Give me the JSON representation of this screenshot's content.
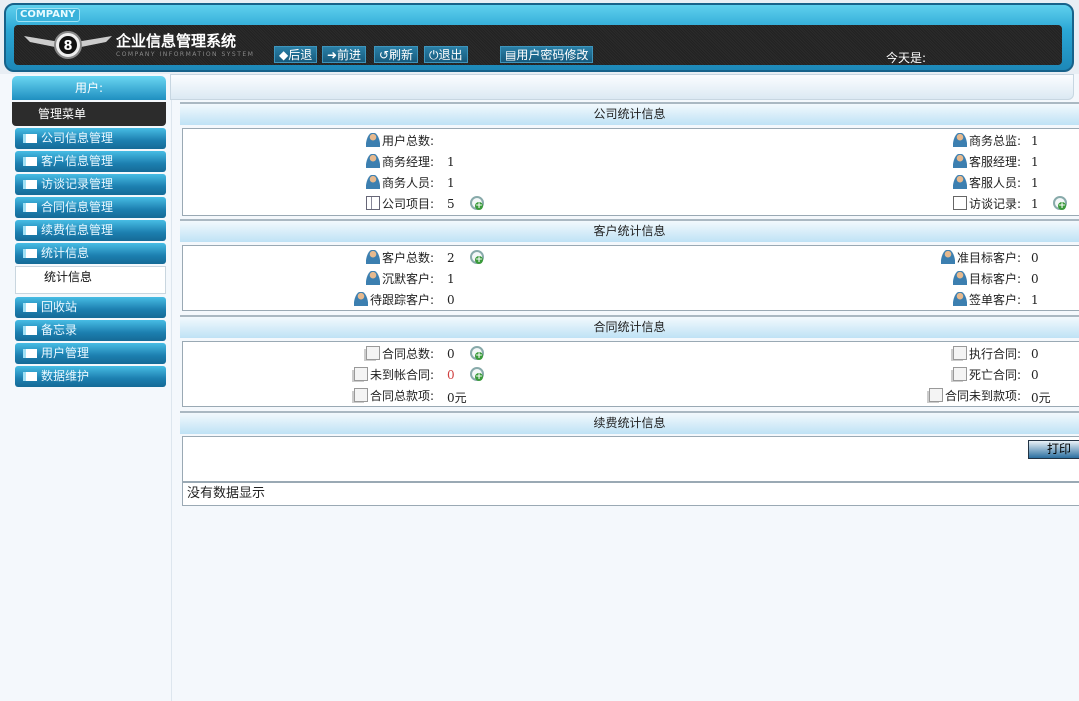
{
  "header": {
    "company_badge": "COMPANY",
    "title": "企业信息管理系统",
    "subtitle": "COMPANY INFORMATION SYSTEM",
    "today_label": "今天是:",
    "toolbar": [
      {
        "icon": "arrow-left-icon",
        "label": "◆后退"
      },
      {
        "icon": "arrow-right-icon",
        "label": "➜前进"
      },
      {
        "icon": "refresh-icon",
        "label": "↺刷新"
      },
      {
        "icon": "power-icon",
        "label": "⏻退出"
      },
      {
        "icon": "key-icon",
        "label": "▤用户密码修改"
      }
    ]
  },
  "user_label": "用户:",
  "sidebar": {
    "menu_title": "管理菜单",
    "items": [
      "公司信息管理",
      "客户信息管理",
      "访谈记录管理",
      "合同信息管理",
      "续费信息管理",
      "统计信息",
      "回收站",
      "备忘录",
      "用户管理",
      "数据维护"
    ],
    "sub_item": "统计信息"
  },
  "sections": [
    {
      "title": "公司统计信息",
      "left": [
        {
          "icon": "person",
          "label": "用户总数:",
          "value": ""
        },
        {
          "icon": "person",
          "label": "商务经理:",
          "value": "1"
        },
        {
          "icon": "person",
          "label": "商务人员:",
          "value": "1"
        },
        {
          "icon": "board",
          "label": "公司项目:",
          "value": "5",
          "search": true
        }
      ],
      "right": [
        {
          "icon": "person",
          "label": "商务总监:",
          "value": "1"
        },
        {
          "icon": "person",
          "label": "客服经理:",
          "value": "1"
        },
        {
          "icon": "person",
          "label": "客服人员:",
          "value": "1"
        },
        {
          "icon": "pencil",
          "label": "访谈记录:",
          "value": "1",
          "search": true
        }
      ]
    },
    {
      "title": "客户统计信息",
      "left": [
        {
          "icon": "person",
          "label": "客户总数:",
          "value": "2",
          "search": true
        },
        {
          "icon": "person",
          "label": "沉默客户:",
          "value": "1"
        },
        {
          "icon": "person",
          "label": "待跟踪客户:",
          "value": "0"
        }
      ],
      "right": [
        {
          "icon": "person",
          "label": "准目标客户:",
          "value": "0"
        },
        {
          "icon": "person",
          "label": "目标客户:",
          "value": "0"
        },
        {
          "icon": "person",
          "label": "签单客户:",
          "value": "1"
        }
      ]
    },
    {
      "title": "合同统计信息",
      "left": [
        {
          "icon": "doc",
          "label": "合同总数:",
          "value": "0",
          "search": true
        },
        {
          "icon": "doc",
          "label": "未到帐合同:",
          "value": "0",
          "search": true,
          "color": "#d04040"
        },
        {
          "icon": "doc",
          "label": "合同总款项:",
          "value": "0元"
        }
      ],
      "right": [
        {
          "icon": "doc",
          "label": "执行合同:",
          "value": "0"
        },
        {
          "icon": "doc",
          "label": "死亡合同:",
          "value": "0"
        },
        {
          "icon": "doc",
          "label": "合同未到款项:",
          "value": "0元"
        }
      ]
    },
    {
      "title": "续费统计信息",
      "left": [],
      "right": []
    }
  ],
  "print_button": "打印",
  "no_data": "没有数据显示"
}
